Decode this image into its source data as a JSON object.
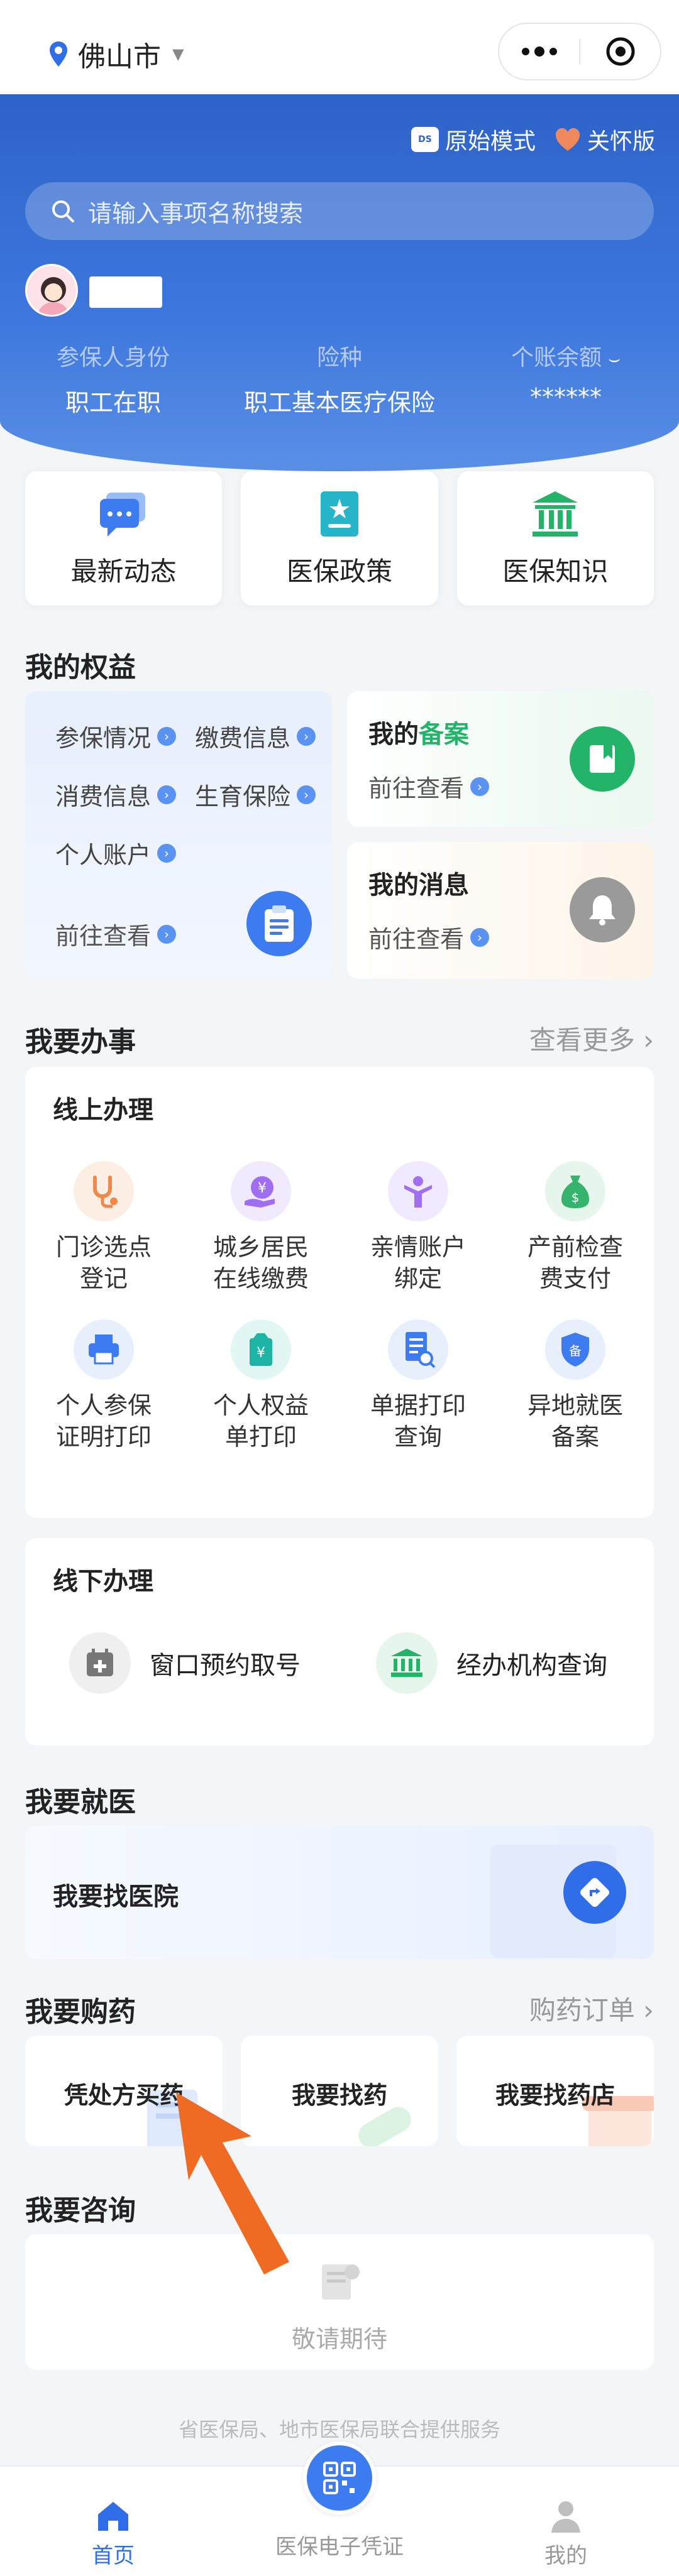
{
  "topbar": {
    "city": "佛山市"
  },
  "header": {
    "mode_original": "原始模式",
    "mode_care": "关怀版",
    "mode_badge": "DS",
    "search_placeholder": "请输入事项名称搜索",
    "info": [
      {
        "label": "参保人身份",
        "value": "职工在职"
      },
      {
        "label": "险种",
        "value": "职工基本医疗保险"
      },
      {
        "label": "个账余额",
        "value": "******"
      }
    ]
  },
  "quick": [
    {
      "label": "最新动态",
      "icon": "news-chat-icon"
    },
    {
      "label": "医保政策",
      "icon": "policy-book-icon"
    },
    {
      "label": "医保知识",
      "icon": "bank-building-icon"
    }
  ],
  "rights": {
    "title": "我的权益",
    "chips": [
      "参保情况",
      "缴费信息",
      "消费信息",
      "生育保险",
      "个人账户"
    ],
    "goto": "前往查看",
    "filing_prefix": "我的",
    "filing_highlight": "备案",
    "messages": "我的消息"
  },
  "affairs": {
    "title": "我要办事",
    "more": "查看更多",
    "online_title": "线上办理",
    "online": [
      {
        "label": "门诊选点\n登记",
        "icon": "stethoscope-icon",
        "color": "#f0884a"
      },
      {
        "label": "城乡居民\n在线缴费",
        "icon": "yen-coin-icon",
        "color": "#a06ef0"
      },
      {
        "label": "亲情账户\n绑定",
        "icon": "family-icon",
        "color": "#a06ef0"
      },
      {
        "label": "产前检查\n费支付",
        "icon": "money-bag-icon",
        "color": "#33b36b"
      },
      {
        "label": "个人参保\n证明打印",
        "icon": "printer-icon",
        "color": "#3c7cf0"
      },
      {
        "label": "个人权益\n单打印",
        "icon": "yen-bag-icon",
        "color": "#1db4a5"
      },
      {
        "label": "单据打印\n查询",
        "icon": "document-search-icon",
        "color": "#3c7cf0"
      },
      {
        "label": "异地就医\n备案",
        "icon": "shield-filing-icon",
        "color": "#3c7cf0"
      }
    ],
    "offline_title": "线下办理",
    "offline": [
      {
        "label": "窗口预约取号",
        "icon": "calendar-plus-icon"
      },
      {
        "label": "经办机构查询",
        "icon": "institution-icon"
      }
    ]
  },
  "doctor": {
    "title": "我要就医",
    "find_hospital": "我要找医院"
  },
  "pharmacy": {
    "title": "我要购药",
    "more": "购药订单",
    "items": [
      "凭处方买药",
      "我要找药",
      "我要找药店"
    ]
  },
  "consult": {
    "title": "我要咨询",
    "coming": "敬请期待"
  },
  "footer_note": "省医保局、地市医保局联合提供服务",
  "tabbar": {
    "home": "首页",
    "voucher": "医保电子凭证",
    "mine": "我的"
  }
}
